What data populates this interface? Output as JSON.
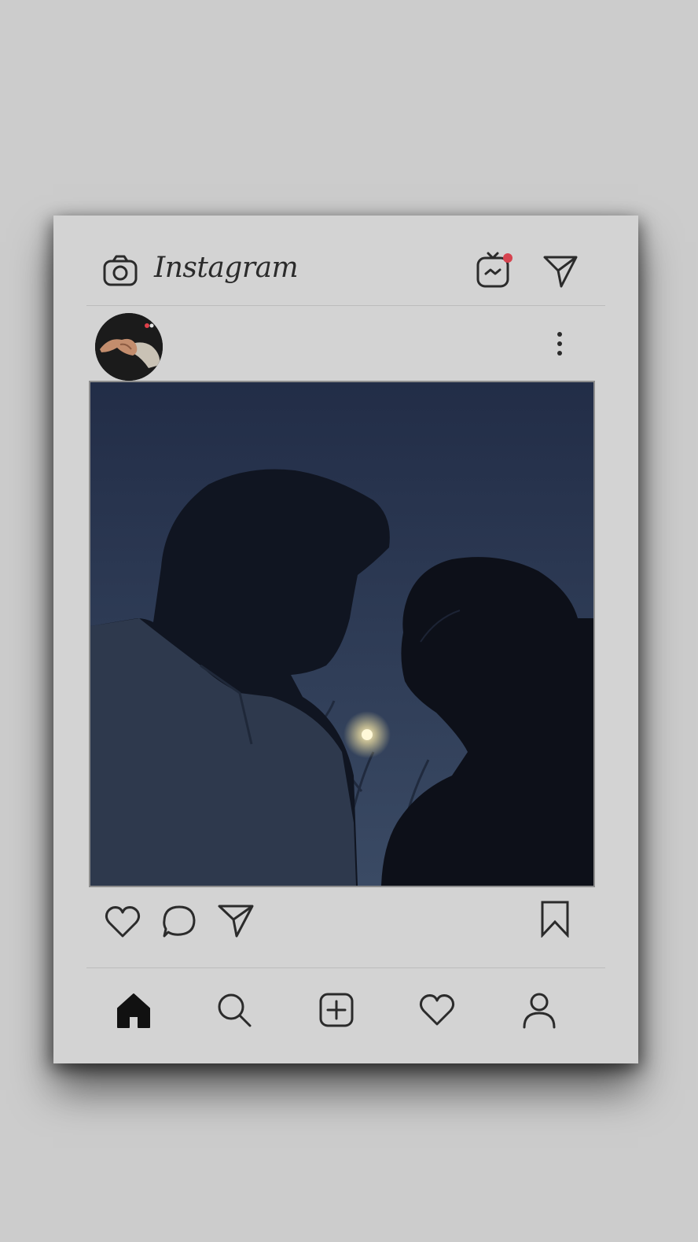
{
  "app": {
    "name": "Instagram"
  },
  "colors": {
    "background": "#cccccc",
    "card": "#d3d3d3",
    "icon": "#2b2b2b",
    "notification_dot": "#d6434f",
    "night_sky": "#2b3a55"
  },
  "icons": {
    "camera": "camera-icon",
    "igtv": "igtv-icon",
    "direct": "paper-plane-icon",
    "more": "vertical-ellipsis-icon",
    "like": "heart-icon",
    "comment": "comment-bubble-icon",
    "share": "paper-plane-icon",
    "save": "bookmark-icon"
  },
  "bottom_nav": [
    {
      "name": "home",
      "icon": "home-icon",
      "active": true
    },
    {
      "name": "search",
      "icon": "search-icon",
      "active": false
    },
    {
      "name": "create",
      "icon": "plus-square-icon",
      "active": false
    },
    {
      "name": "activity",
      "icon": "heart-icon",
      "active": false
    },
    {
      "name": "profile",
      "icon": "person-icon",
      "active": false
    }
  ]
}
